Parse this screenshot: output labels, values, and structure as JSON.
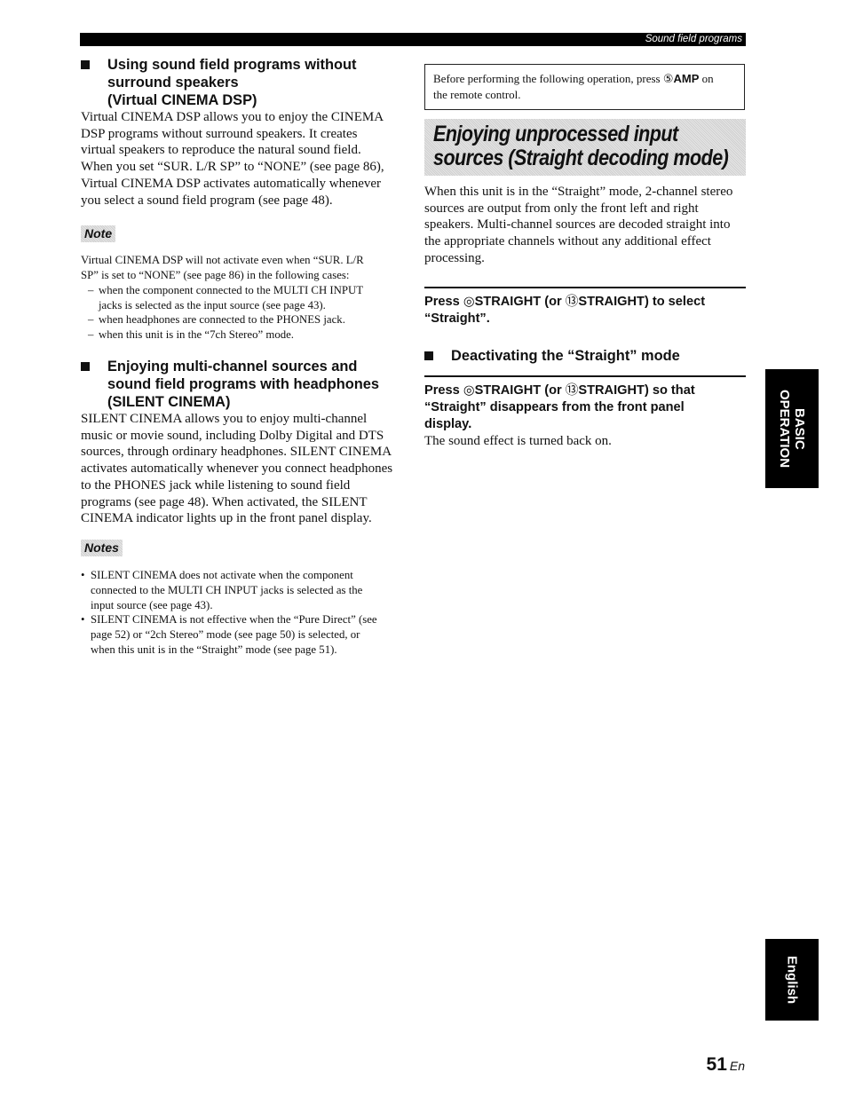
{
  "header": {
    "section_label": "Sound field programs"
  },
  "left": {
    "virtual": {
      "heading": [
        "Using sound field programs without",
        "surround speakers",
        "(Virtual CINEMA DSP)"
      ],
      "body": [
        "Virtual CINEMA DSP allows you to enjoy the CINEMA",
        "DSP programs without surround speakers. It creates",
        "virtual speakers to reproduce the natural sound field.",
        "When you set “SUR. L/R SP” to “NONE” (see page 86),",
        "Virtual CINEMA DSP activates automatically whenever",
        "you select a sound field program (see page 48)."
      ]
    },
    "note": {
      "label": "Note",
      "intro": [
        "Virtual CINEMA DSP will not activate even when “SUR. L/R",
        "SP” is set to “NONE” (see page 86) in the following cases:"
      ],
      "items": [
        [
          "when the component connected to the MULTI CH INPUT",
          "jacks is selected as the input source (see page 43)."
        ],
        [
          "when headphones are connected to the PHONES jack."
        ],
        [
          "when this unit is in the “7ch Stereo” mode."
        ]
      ]
    },
    "silent": {
      "heading": [
        "Enjoying multi-channel sources and",
        "sound field programs with headphones",
        "(SILENT CINEMA)"
      ],
      "body": [
        "SILENT CINEMA allows you to enjoy multi-channel",
        "music or movie sound, including Dolby Digital and DTS",
        "sources, through ordinary headphones. SILENT CINEMA",
        "activates automatically whenever you connect headphones",
        "to the PHONES jack while listening to sound field",
        "programs (see page 48). When activated, the SILENT",
        "CINEMA indicator lights up in the front panel display."
      ]
    },
    "notes": {
      "label": "Notes",
      "items": [
        [
          "SILENT CINEMA does not activate when the component",
          "connected to the MULTI CH INPUT jacks is selected as the",
          "input source (see page 43)."
        ],
        [
          "SILENT CINEMA is not effective when the “Pure Direct” (see",
          "page 52) or “2ch Stereo” mode (see page 50) is selected, or",
          "when this unit is in the “Straight” mode (see page 51)."
        ]
      ]
    }
  },
  "right": {
    "prebox": {
      "text_before": "Before performing the following operation, press ",
      "key_num": "⑤",
      "key": "AMP",
      "text_after_1": " on",
      "line2": "the remote control."
    },
    "banner": [
      "Enjoying unprocessed input",
      "sources (Straight decoding mode)"
    ],
    "intro": [
      "When this unit is in the “Straight” mode, 2-channel stereo",
      "sources are output from only the front left and right",
      "speakers. Multi-channel sources are decoded straight into",
      "the appropriate channels without any additional effect",
      "processing."
    ],
    "step1": {
      "line1_a": "Press ",
      "icon_a": "◎",
      "key_a": "STRAIGHT",
      "line1_b": " (or ",
      "icon_b": "⑬",
      "key_b": "STRAIGHT",
      "line1_c": ") to select",
      "line2": "“Straight”."
    },
    "deact": {
      "heading": "Deactivating the “Straight” mode",
      "step": {
        "line1_a": "Press ",
        "icon_a": "◎",
        "key_a": "STRAIGHT",
        "line1_b": " (or ",
        "icon_b": "⑬",
        "key_b": "STRAIGHT",
        "line1_c": ") so that",
        "line2": "“Straight” disappears from the front panel",
        "line3": "display."
      },
      "result": "The sound effect is turned back on."
    }
  },
  "side_tabs": {
    "basic": [
      "BASIC",
      "OPERATION"
    ],
    "lang": "English"
  },
  "footer": {
    "page_number": "51",
    "lang_suffix": "En"
  }
}
